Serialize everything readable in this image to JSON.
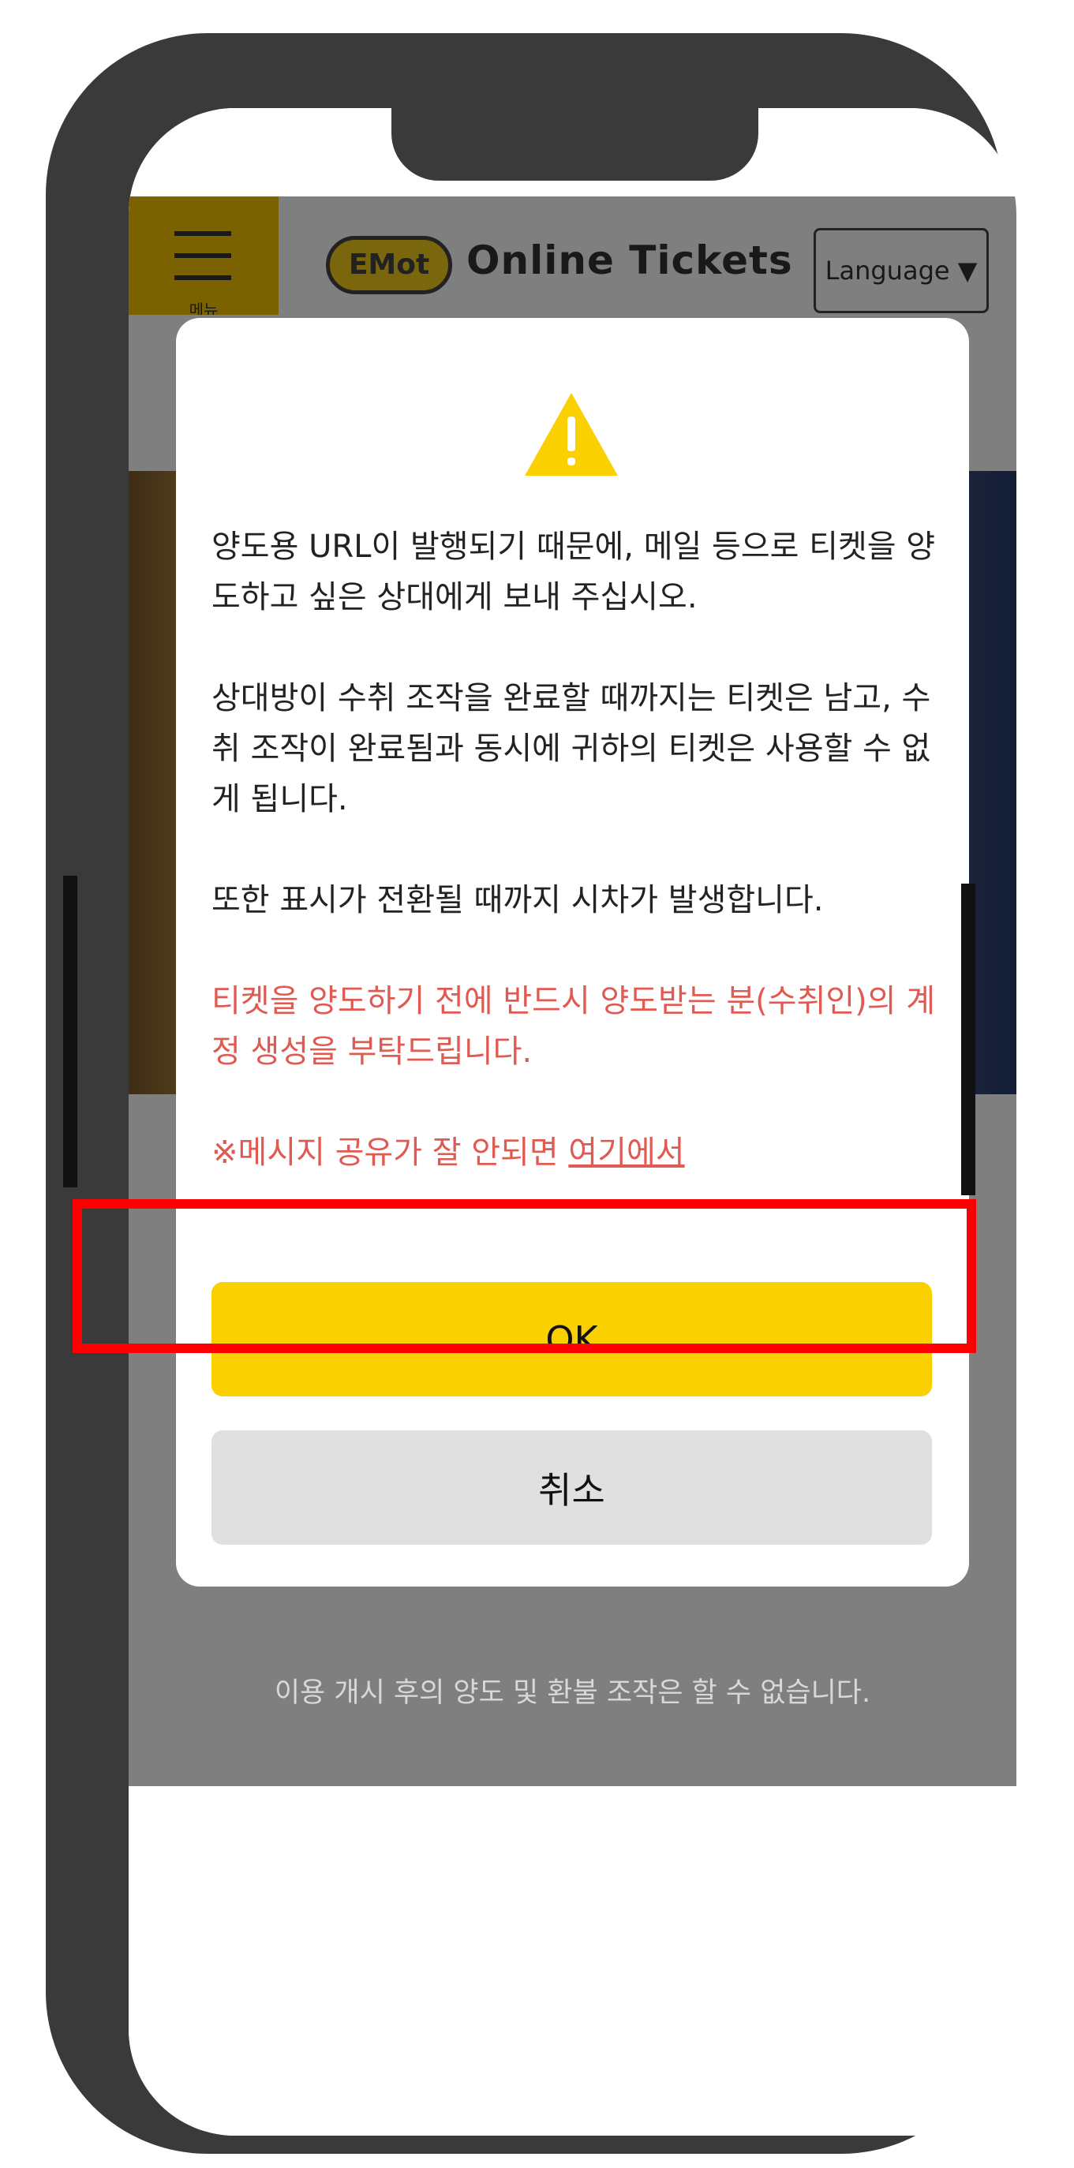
{
  "header": {
    "menu_label": "메뉴",
    "logo_badge": "EMot",
    "logo_text": "Online Tickets",
    "language_button": "Language ▼"
  },
  "dialog": {
    "paragraph_1": "양도용 URL이 발행되기 때문에, 메일 등으로 티켓을 양도하고 싶은 상대에게 보내 주십시오.",
    "paragraph_2": "상대방이 수취 조작을 완료할 때까지는 티켓은 남고, 수취 조작이 완료됨과 동시에 귀하의 티켓은 사용할 수 없게 됩니다.",
    "paragraph_3": "또한 표시가 전환될 때까지 시차가 발생합니다.",
    "warning_text": "티켓을 양도하기 전에 반드시 양도받는 분(수취인)의 계정 생성을 부탁드립니다.",
    "share_note_prefix": "※메시지 공유가 잘 안되면 ",
    "share_note_link": "여기에서",
    "ok_label": "OK",
    "cancel_label": "취소"
  },
  "footnote": "이용 개시 후의 양도 및 환불 조작은 할 수 없습니다.",
  "colors": {
    "accent_yellow": "#fad000",
    "warning_red": "#e05a52",
    "highlight_red": "#ff0000"
  }
}
